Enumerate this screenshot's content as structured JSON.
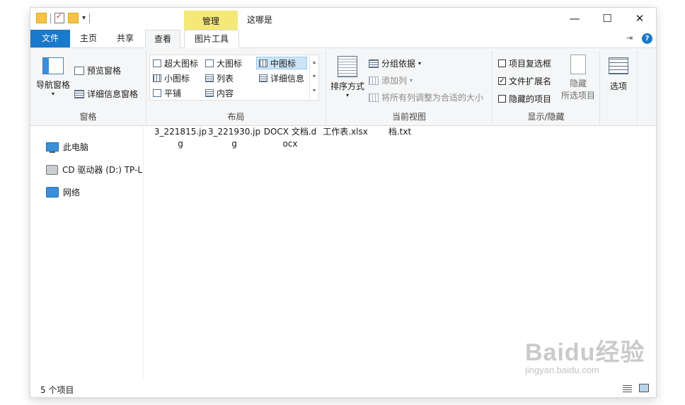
{
  "window": {
    "title": "这哪是",
    "context_tab_label": "管理",
    "controls": {
      "minimize": "—",
      "maximize": "☐",
      "close": "✕"
    }
  },
  "quick_access": {
    "dropdown": "▾"
  },
  "ribbon_tabs": {
    "file": "文件",
    "home": "主页",
    "share": "共享",
    "view": "查看",
    "picture_tools": "图片工具",
    "active": "查看"
  },
  "ribbon": {
    "panes": {
      "label": "窗格",
      "nav_pane": "导航窗格",
      "preview_pane": "预览窗格",
      "details_pane": "详细信息窗格"
    },
    "layout": {
      "label": "布局",
      "options": [
        "超大图标",
        "大图标",
        "中图标",
        "小图标",
        "列表",
        "详细信息",
        "平铺",
        "内容"
      ],
      "selected": "中图标"
    },
    "current_view": {
      "label": "当前视图",
      "sort_by": "排序方式",
      "group_by": "分组依据",
      "add_column": "添加列",
      "fit_columns": "将所有列调整为合适的大小"
    },
    "show_hide": {
      "label": "显示/隐藏",
      "item_checkboxes": {
        "label": "项目复选框",
        "checked": false
      },
      "file_extensions": {
        "label": "文件扩展名",
        "checked": true
      },
      "hidden_items": {
        "label": "隐藏的项目",
        "checked": false
      },
      "hide_selected_line1": "隐藏",
      "hide_selected_line2": "所选项目"
    },
    "options": {
      "label": "选项"
    }
  },
  "nav_pane": {
    "items": [
      "此电脑",
      "CD 驱动器 (D:) TP-L",
      "网络"
    ]
  },
  "files": [
    "3_221815.jpg",
    "3_221930.jpg",
    "DOCX 文档.docx",
    "工作表.xlsx",
    "档.txt"
  ],
  "status_bar": {
    "item_count": "5 个项目"
  },
  "watermark": {
    "main": "Baidu经验",
    "sub": "jingyan.baidu.com"
  },
  "colors": {
    "accent": "#1979ca",
    "context_tab": "#f4e878",
    "selection": "#cce4f7"
  }
}
